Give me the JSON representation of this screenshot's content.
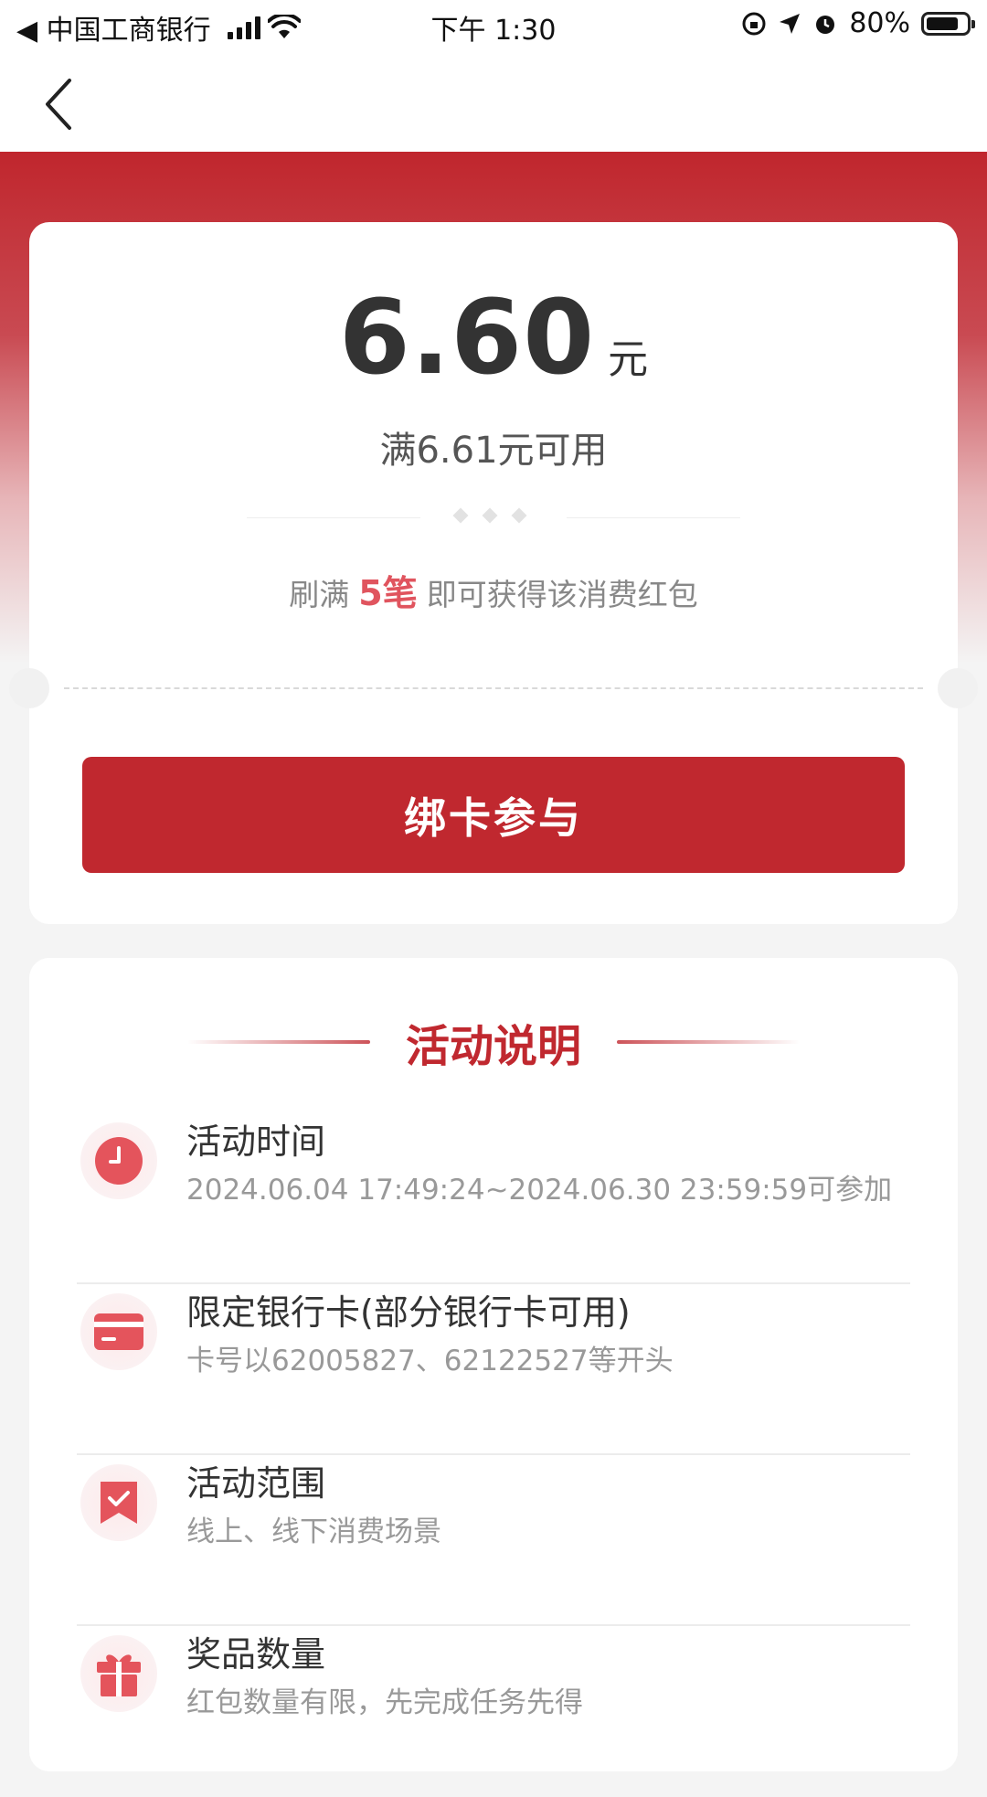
{
  "status_bar": {
    "back_app": "◀ 中国工商银行",
    "time": "下午 1:30",
    "battery": "80%",
    "battery_level": 0.8
  },
  "coupon": {
    "amount": "6.60",
    "unit": "元",
    "condition": "满6.61元可用",
    "task_prefix": "刷满",
    "task_count": "5笔",
    "task_suffix": "即可获得该消费红包",
    "bind_button": "绑卡参与"
  },
  "rules": {
    "title": "活动说明",
    "items": [
      {
        "icon": "clock-icon",
        "title": "活动时间",
        "desc": "2024.06.04 17:49:24~2024.06.30 23:59:59可参加"
      },
      {
        "icon": "card-icon",
        "title": "限定银行卡(部分银行卡可用)",
        "desc": "卡号以62005827、62122527等开头"
      },
      {
        "icon": "bookmark-check-icon",
        "title": "活动范围",
        "desc": "线上、线下消费场景"
      },
      {
        "icon": "gift-icon",
        "title": "奖品数量",
        "desc": "红包数量有限，先完成任务先得"
      }
    ]
  },
  "colors": {
    "brand_red": "#c0282f",
    "highlight_red": "#e0545e",
    "icon_red": "#e4545c"
  }
}
